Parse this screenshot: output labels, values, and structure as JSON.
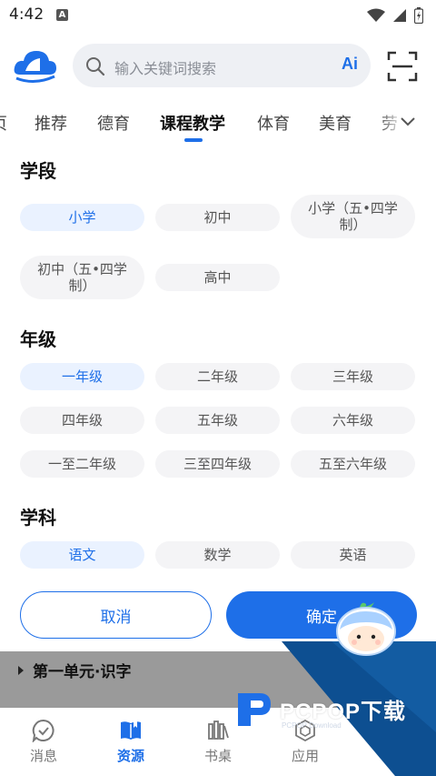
{
  "status_bar": {
    "time": "4:42",
    "notification_letter": "A"
  },
  "search": {
    "placeholder": "输入关键词搜索",
    "ai_label": "Ai"
  },
  "tabs": [
    {
      "label": "页"
    },
    {
      "label": "推荐"
    },
    {
      "label": "德育"
    },
    {
      "label": "课程教学",
      "active": true
    },
    {
      "label": "体育"
    },
    {
      "label": "美育"
    },
    {
      "label": "劳"
    }
  ],
  "filters": {
    "stage": {
      "title": "学段",
      "options": [
        "小学",
        "初中",
        "小学（五•四学制）",
        "初中（五•四学制）",
        "高中"
      ],
      "selected": "小学"
    },
    "grade": {
      "title": "年级",
      "options": [
        "一年级",
        "二年级",
        "三年级",
        "四年级",
        "五年级",
        "六年级",
        "一至二年级",
        "三至四年级",
        "五至六年级"
      ],
      "selected": "一年级"
    },
    "subject": {
      "title": "学科",
      "options": [
        "语文",
        "数学",
        "英语"
      ],
      "selected": "语文"
    }
  },
  "actions": {
    "cancel": "取消",
    "confirm": "确定"
  },
  "list": {
    "unit_title": "第一单元·识字"
  },
  "watermark": {
    "brand": "PCPOP下载",
    "sub": "PCPOP Download"
  },
  "bottom_nav": [
    {
      "label": "消息",
      "icon": "message-check-icon"
    },
    {
      "label": "资源",
      "icon": "book-icon",
      "active": true
    },
    {
      "label": "书桌",
      "icon": "bookshelf-icon"
    },
    {
      "label": "应用",
      "icon": "apps-hexagon-icon"
    }
  ],
  "colors": {
    "accent": "#1e6fe8",
    "chip_bg": "#f4f4f6",
    "chip_selected_bg": "#eaf2ff"
  }
}
